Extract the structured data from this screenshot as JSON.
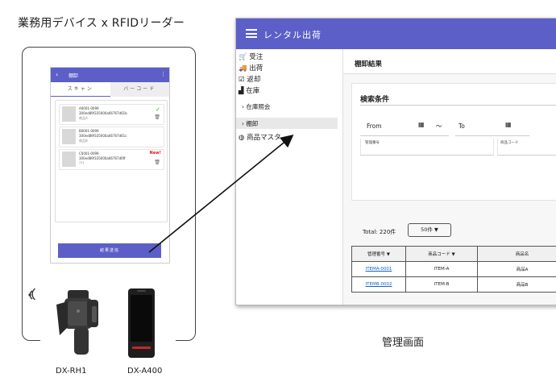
{
  "left_title": "業務用デバイス x RFIDリーダー",
  "phone": {
    "header_title": "棚卸",
    "back_icon": "‹",
    "menu_icon": "⋮",
    "tabs": [
      "スキャン",
      "バーコード"
    ],
    "items": [
      {
        "id": "A0001-0099",
        "epc": "300ed89f335000a66767d61b",
        "name": "商品A",
        "badge": "check"
      },
      {
        "id": "B0001-0099",
        "epc": "300ed89f335000a66767d61c",
        "name": "商品B",
        "badge": ""
      },
      {
        "id": "C0001-0099",
        "epc": "300ed89f335000a66767d6ff",
        "name": "???",
        "badge": "New!"
      }
    ],
    "send_button": "結果送信"
  },
  "devices": [
    {
      "label": "DX-RH1"
    },
    {
      "label": "DX-A400"
    }
  ],
  "admin": {
    "window_title": "レンタル出荷",
    "sidebar": [
      {
        "icon": "cart-icon",
        "label": "受注"
      },
      {
        "icon": "truck-icon",
        "label": "出荷"
      },
      {
        "icon": "return-icon",
        "label": "返却"
      },
      {
        "icon": "warehouse-icon",
        "label": "在庫"
      },
      {
        "label": "在庫照会",
        "sub": true
      },
      {
        "label": "棚卸",
        "sub": true,
        "active": true
      },
      {
        "icon": "database-icon",
        "label": "商品マスタ"
      }
    ],
    "page_title": "棚卸結果",
    "search": {
      "title": "検索条件",
      "from_label": "From",
      "tilde": "～",
      "to_label": "To",
      "field1_label": "管理番号",
      "field2_label": "商品コード"
    },
    "total": "Total: 220件",
    "page_size": "50件 ▼",
    "table": {
      "headers": [
        "管理番号",
        "商品コード",
        "商品名"
      ],
      "rows": [
        [
          "ITEMA-0001",
          "ITEM-A",
          "商品A"
        ],
        [
          "ITEMB-0002",
          "ITEM-B",
          "商品B"
        ]
      ]
    }
  },
  "admin_label": "管理画面",
  "colors": {
    "accent": "#5b5fc7",
    "new_badge": "#e31b1b",
    "check": "#2ca02c",
    "link": "#1565c0"
  }
}
